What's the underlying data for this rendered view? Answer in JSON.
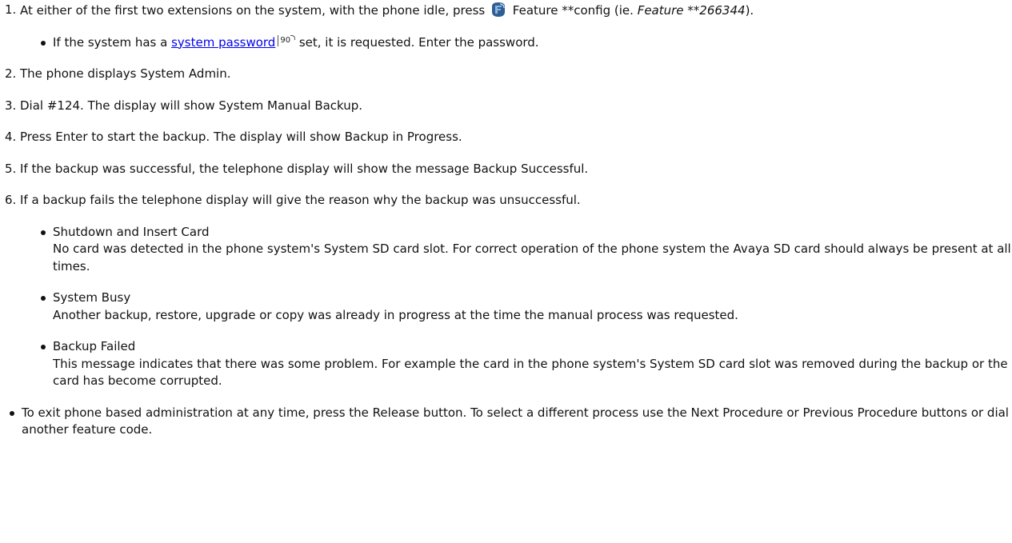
{
  "steps": [
    {
      "num": "1.",
      "before_icon": "At either of the first two extensions on the system, with the phone idle, press",
      "icon": "feature-key-icon",
      "after_icon": " Feature **config (ie. ",
      "italic": "Feature **266344",
      "end": ").",
      "bullet": {
        "before_link": "If the system has a ",
        "link": "system password",
        "page_ref": "90",
        "after_link": " set, it is requested. Enter the password."
      }
    },
    {
      "num": "2.",
      "text": "The phone displays System Admin."
    },
    {
      "num": "3.",
      "text": "Dial #124. The display will show System Manual Backup."
    },
    {
      "num": "4.",
      "text": "Press Enter to start the backup. The display will show Backup in Progress."
    },
    {
      "num": "5.",
      "text": "If the backup was successful, the telephone display will show the message Backup Successful."
    },
    {
      "num": "6.",
      "text": "If a backup fails the telephone display will give the reason why the backup was unsuccessful.",
      "reasons": [
        {
          "title": "Shutdown and Insert Card",
          "desc": "No card was detected in the phone system's System SD card slot. For correct operation of the phone system the Avaya SD card should always be present at all times."
        },
        {
          "title": "System Busy",
          "desc": "Another backup, restore, upgrade or copy was already in progress at the time the manual process was requested."
        },
        {
          "title": "Backup Failed",
          "desc": "This message indicates that there was some problem. For example the card in the phone system's System SD card slot was removed during the backup or the card has become corrupted."
        }
      ]
    }
  ],
  "note": "To exit phone based administration at any time, press the Release button. To select a different process use the Next Procedure or Previous Procedure buttons or dial another feature code.",
  "colors": {
    "link": "#0000ee",
    "icon_primary": "#2f5e93",
    "icon_highlight": "#8cb4e0"
  }
}
